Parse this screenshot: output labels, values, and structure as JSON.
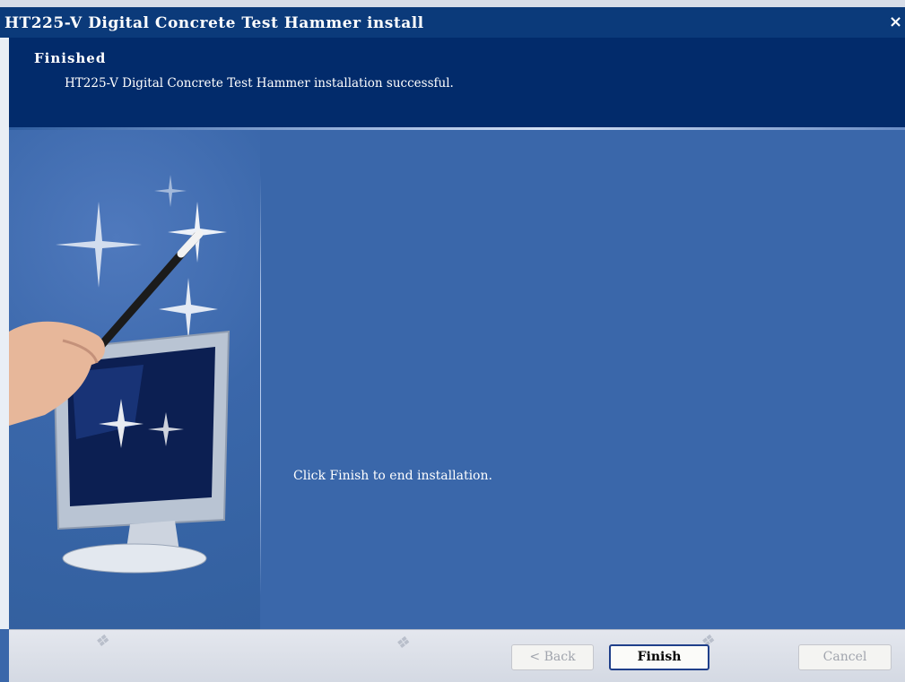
{
  "window": {
    "title": "HT225-V  Digital  Concrete Test Hammer install",
    "close_glyph": "×"
  },
  "header": {
    "title": "Finished",
    "subtitle": "HT225-V  Digital  Concrete Test Hammer installation successful."
  },
  "body": {
    "message": "Click Finish to end installation."
  },
  "footer": {
    "back_label": "< Back",
    "finish_label": "Finish",
    "cancel_label": "Cancel",
    "back_enabled": false,
    "cancel_enabled": false
  },
  "icons": [
    "close-icon",
    "magic-wand-icon",
    "monitor-icon",
    "sparkle-icon"
  ],
  "colors": {
    "title_bar": "#0b3a7a",
    "header_banner": "#022b6b",
    "body_background": "#3a67aa",
    "footer_background": "#d4d9e3"
  }
}
